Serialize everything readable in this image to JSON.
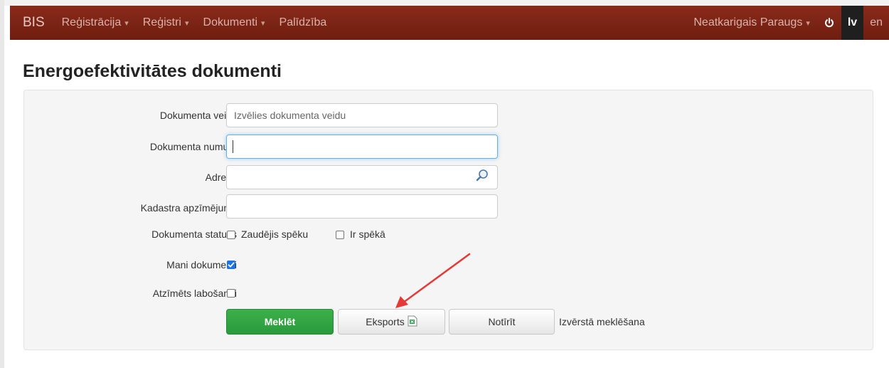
{
  "navbar": {
    "brand": "BIS",
    "menu": [
      {
        "label": "Reģistrācija",
        "has_caret": true
      },
      {
        "label": "Reģistri",
        "has_caret": true
      },
      {
        "label": "Dokumenti",
        "has_caret": true
      },
      {
        "label": "Palīdzība",
        "has_caret": false
      }
    ],
    "user": "Neatkarigais Paraugs",
    "languages": [
      {
        "code": "lv",
        "active": true
      },
      {
        "code": "en",
        "active": false
      }
    ]
  },
  "page": {
    "title": "Energoefektivitātes dokumenti"
  },
  "form": {
    "doc_type": {
      "label": "Dokumenta veids",
      "placeholder": "Izvēlies dokumenta veidu"
    },
    "doc_number": {
      "label": "Dokumenta numurs",
      "value": ""
    },
    "address": {
      "label": "Adrese",
      "value": ""
    },
    "cadastre": {
      "label": "Kadastra apzīmējums",
      "value": ""
    },
    "status": {
      "label": "Dokumenta statuss",
      "options": [
        {
          "label": "Zaudējis spēku",
          "checked": false
        },
        {
          "label": "Ir spēkā",
          "checked": false
        }
      ]
    },
    "my_docs": {
      "label": "Mani dokumenti",
      "checked": true
    },
    "marked": {
      "label": "Atzīmēts labošanai",
      "checked": false
    }
  },
  "buttons": {
    "search": "Meklēt",
    "export": "Eksports",
    "clear": "Notīrīt",
    "advanced": "Izvērstā meklēšana"
  },
  "colors": {
    "navbar": "#7b2414",
    "primary_button": "#2ea043",
    "checkbox_checked": "#1a73e8",
    "annotation_arrow": "#e53935"
  },
  "icons": {
    "power": "power-icon",
    "address_search": "magnifier-icon",
    "export": "excel-file-icon"
  }
}
